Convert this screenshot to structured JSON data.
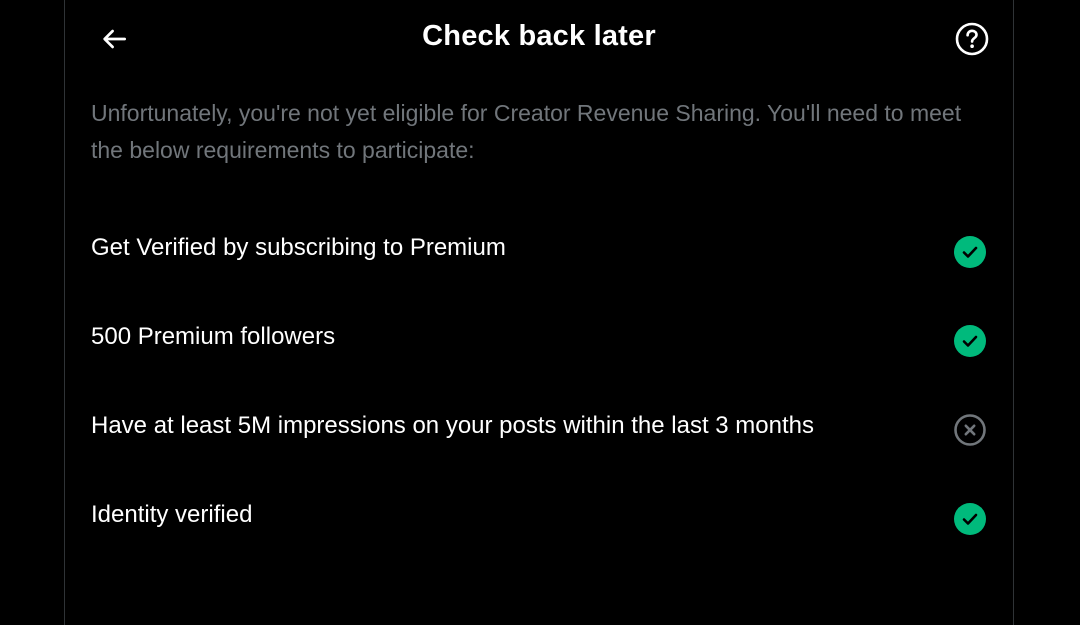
{
  "header": {
    "title": "Check back later",
    "back_icon": "arrow-left-icon",
    "help_icon": "question-circle-icon"
  },
  "description": "Unfortunately, you're not yet eligible for Creator Revenue Sharing. You'll need to meet the below requirements to participate:",
  "requirements": [
    {
      "label": "Get Verified by subscribing to Premium",
      "status": "met",
      "icon": "check-circle-icon"
    },
    {
      "label": "500 Premium followers",
      "status": "met",
      "icon": "check-circle-icon"
    },
    {
      "label": "Have at least 5M impressions on your posts within the last 3 months",
      "status": "not-met",
      "icon": "x-circle-icon"
    },
    {
      "label": "Identity verified",
      "status": "met",
      "icon": "check-circle-icon"
    }
  ],
  "colors": {
    "background": "#000000",
    "met": "#00ba7c",
    "not_met": "#71767b",
    "description_text": "#71767b",
    "primary_text": "#ffffff"
  }
}
